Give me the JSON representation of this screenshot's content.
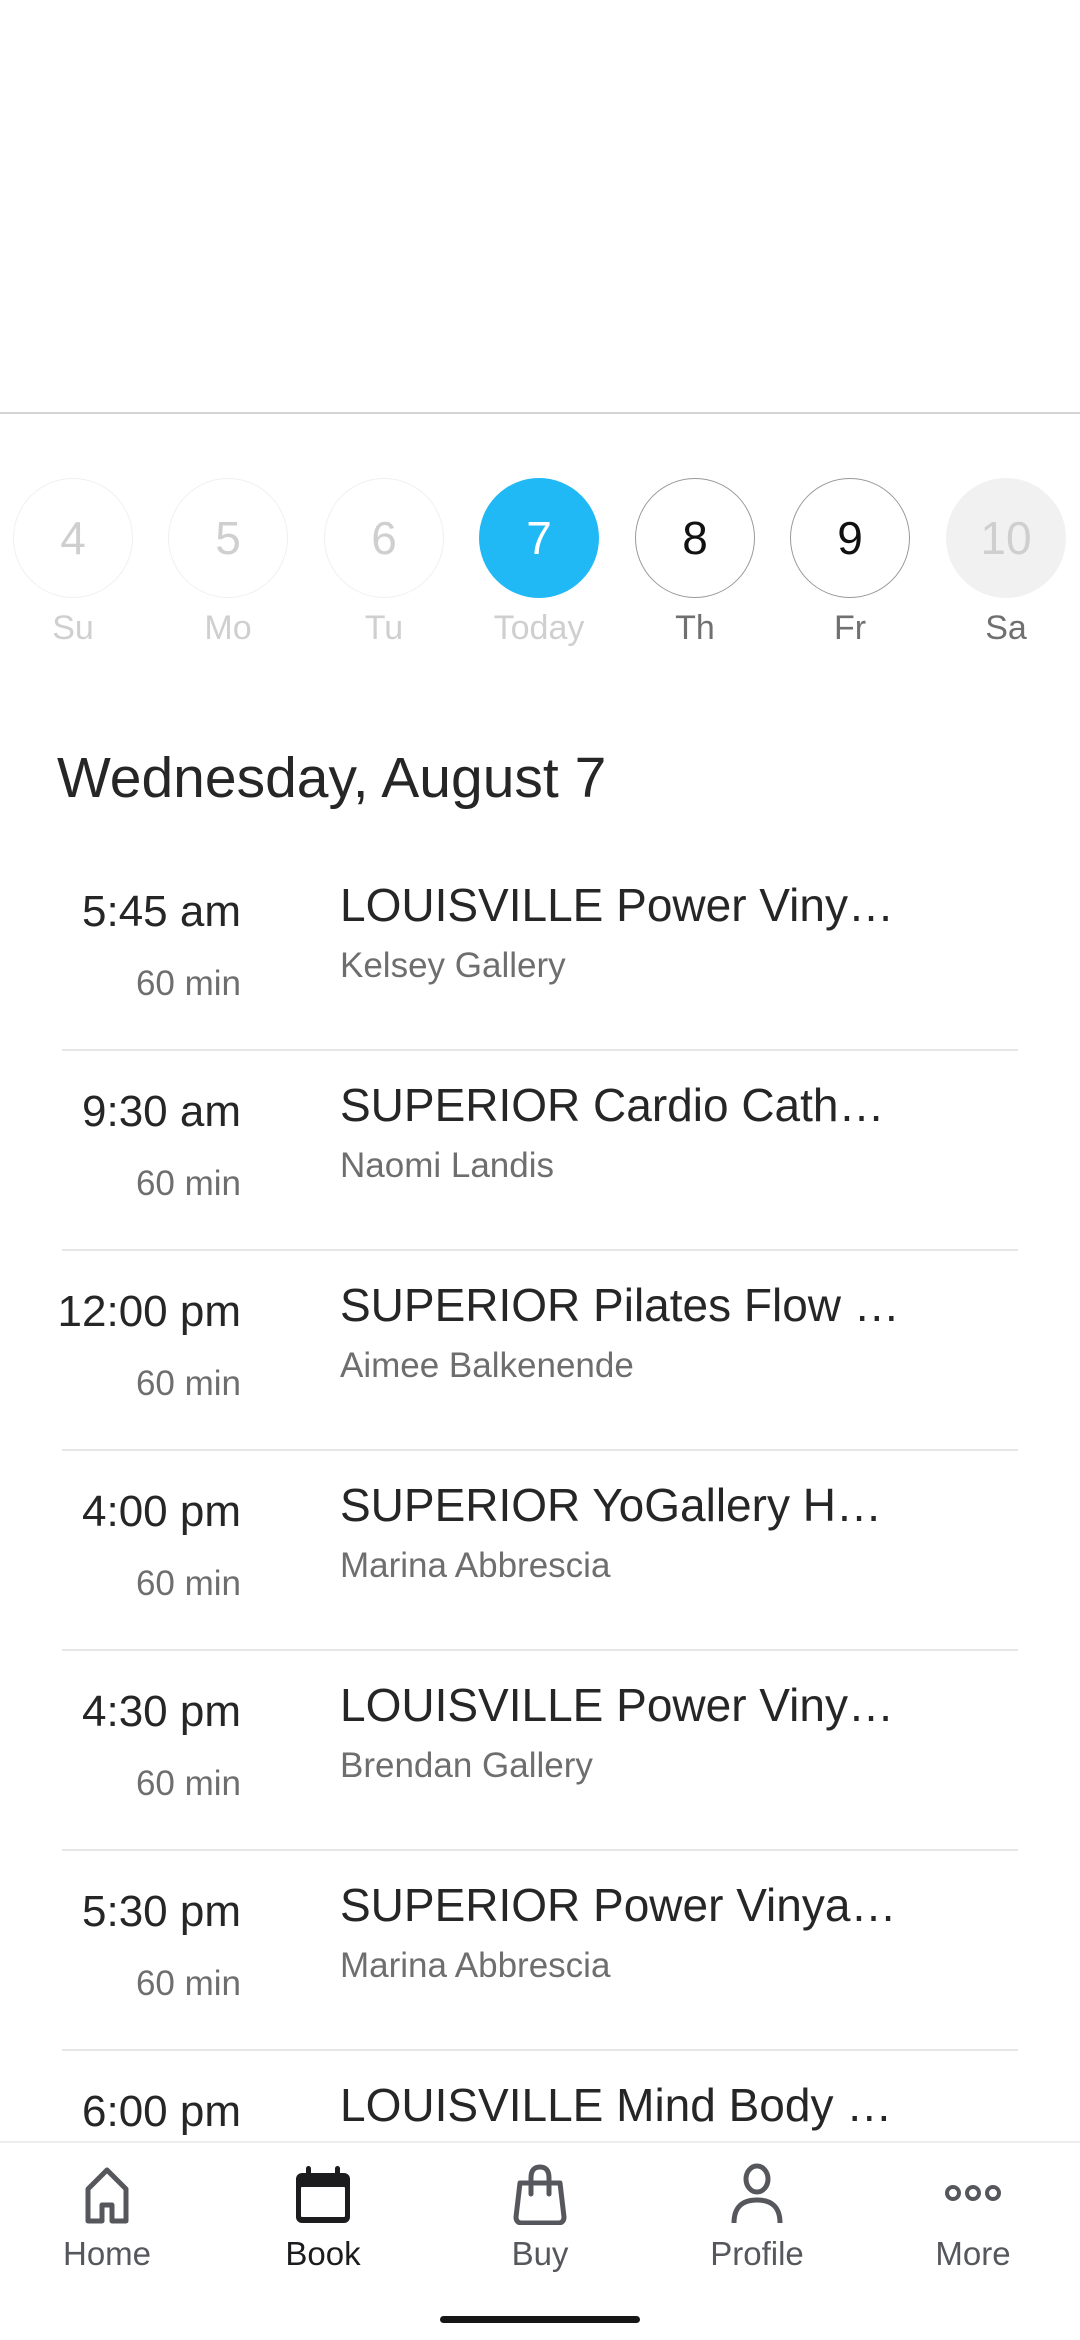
{
  "day_selector": {
    "days": [
      {
        "number": "4",
        "label": "Su",
        "state": "past"
      },
      {
        "number": "5",
        "label": "Mo",
        "state": "past"
      },
      {
        "number": "6",
        "label": "Tu",
        "state": "past"
      },
      {
        "number": "7",
        "label": "Today",
        "state": "today"
      },
      {
        "number": "8",
        "label": "Th",
        "state": "future"
      },
      {
        "number": "9",
        "label": "Fr",
        "state": "future"
      },
      {
        "number": "10",
        "label": "Sa",
        "state": "disabled"
      }
    ],
    "accent_color": "#20b9f5"
  },
  "schedule": {
    "heading": "Wednesday, August 7",
    "classes": [
      {
        "time": "5:45 am",
        "duration": "60 min",
        "title": "LOUISVILLE Power Viny…",
        "instructor": "Kelsey Gallery"
      },
      {
        "time": "9:30 am",
        "duration": "60 min",
        "title": "SUPERIOR Cardio Cath…",
        "instructor": "Naomi Landis"
      },
      {
        "time": "12:00 pm",
        "duration": "60 min",
        "title": "SUPERIOR Pilates Flow …",
        "instructor": "Aimee Balkenende"
      },
      {
        "time": "4:00 pm",
        "duration": "60 min",
        "title": "SUPERIOR YoGallery H…",
        "instructor": "Marina Abbrescia"
      },
      {
        "time": "4:30 pm",
        "duration": "60 min",
        "title": "LOUISVILLE Power Viny…",
        "instructor": "Brendan Gallery"
      },
      {
        "time": "5:30 pm",
        "duration": "60 min",
        "title": "SUPERIOR Power Vinya…",
        "instructor": "Marina Abbrescia"
      },
      {
        "time": "6:00 pm",
        "duration": "",
        "title": "LOUISVILLE Mind Body …",
        "instructor": ""
      }
    ]
  },
  "bottom_nav": {
    "items": [
      {
        "label": "Home",
        "icon": "home-icon",
        "active": false
      },
      {
        "label": "Book",
        "icon": "calendar-icon",
        "active": true
      },
      {
        "label": "Buy",
        "icon": "shopping-bag-icon",
        "active": false
      },
      {
        "label": "Profile",
        "icon": "person-icon",
        "active": false
      },
      {
        "label": "More",
        "icon": "more-dots-icon",
        "active": false
      }
    ]
  }
}
